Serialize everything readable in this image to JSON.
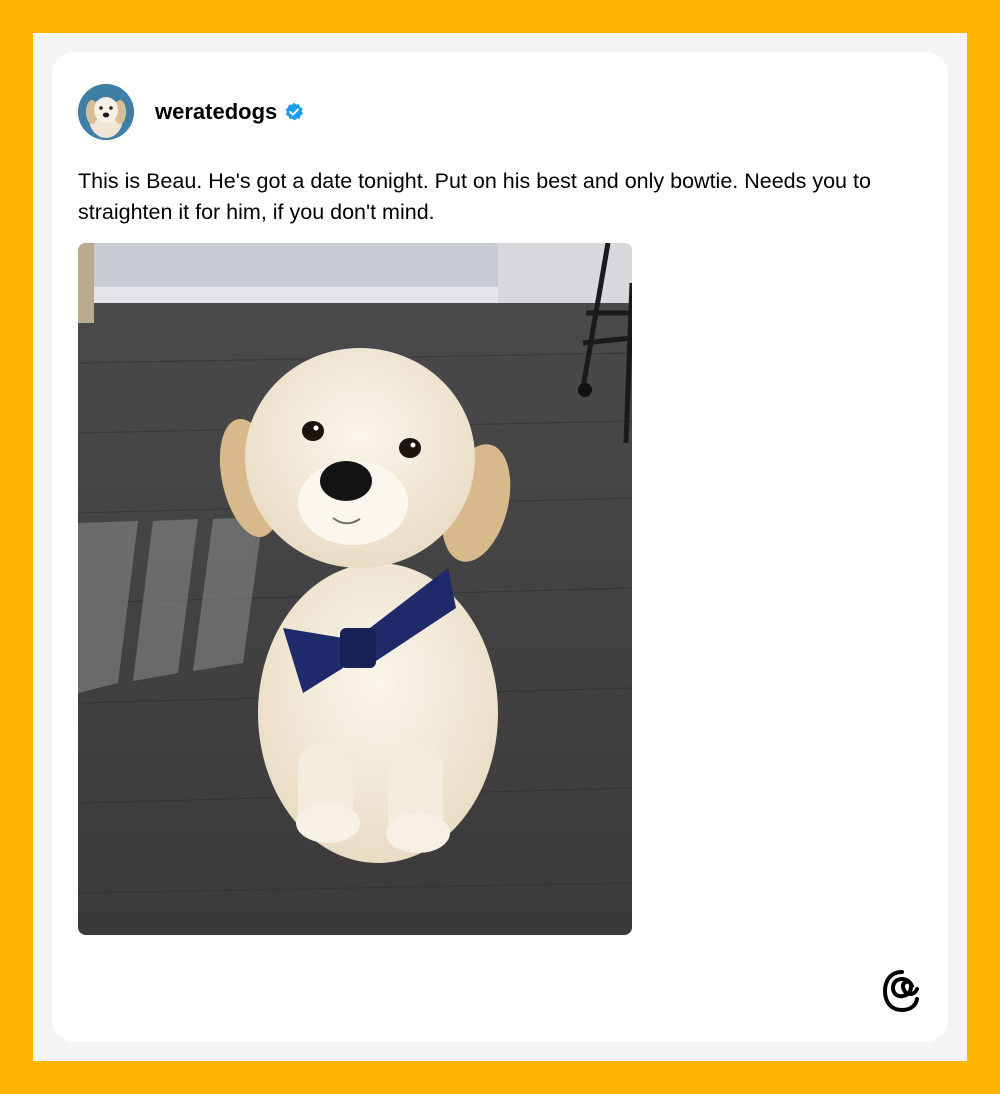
{
  "post": {
    "username": "weratedogs",
    "verified": true,
    "text": "This is Beau. He's got a date tonight. Put on his best and only bowtie. Needs you to straighten it for him, if you don't mind.",
    "image_icon": "photo-golden-retriever-puppy-with-navy-bowtie",
    "avatar_icon": "avatar-dog-icon",
    "verified_icon": "verified-badge-icon",
    "brand_icon": "threads-logo-icon"
  },
  "colors": {
    "outer_border": "#FFB400",
    "frame": "#F4F4F4",
    "card": "#FFFFFF",
    "verified_blue": "#1D9BF0",
    "bowtie": "#1F2A6B",
    "text": "#000000"
  }
}
